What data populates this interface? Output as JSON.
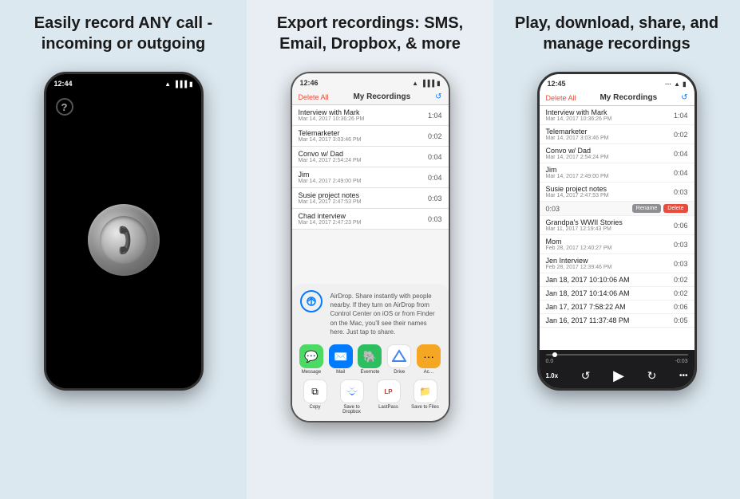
{
  "panels": [
    {
      "id": "panel-1",
      "title": "Easily record ANY call - incoming or outgoing",
      "status_time": "12:44",
      "bg": "black",
      "question_mark": "?",
      "record_button_aria": "Record button"
    },
    {
      "id": "panel-2",
      "title": "Export recordings: SMS, Email, Dropbox, & more",
      "status_time": "12:46",
      "header": {
        "delete_all": "Delete All",
        "title": "My Recordings",
        "refresh_icon": "↺"
      },
      "recordings": [
        {
          "name": "Interview with Mark",
          "date": "Mar 14, 2017 10:36:26 PM",
          "duration": "1:04"
        },
        {
          "name": "Telemarketer",
          "date": "Mar 14, 2017 3:03:46 PM",
          "duration": "0:02"
        },
        {
          "name": "Convo w/ Dad",
          "date": "Mar 14, 2017 2:54:24 PM",
          "duration": "0:04"
        },
        {
          "name": "Jim",
          "date": "Mar 14, 2017 2:49:00 PM",
          "duration": "0:04"
        },
        {
          "name": "Susie project notes",
          "date": "Mar 14, 2017 2:47:53 PM",
          "duration": "0:03"
        },
        {
          "name": "Chad interview",
          "date": "Mar 14, 2017 2:47:23 PM",
          "duration": "0:03"
        }
      ],
      "airdrop_text": "AirDrop. Share instantly with people nearby. If they turn on AirDrop from Control Center on iOS or from Finder on the Mac, you'll see their names here. Just tap to share.",
      "share_apps": [
        {
          "label": "Message",
          "color": "#4cd964",
          "icon": "💬"
        },
        {
          "label": "Mail",
          "color": "#007aff",
          "icon": "✉️"
        },
        {
          "label": "Evernote",
          "color": "#2dbe60",
          "icon": "🐘"
        },
        {
          "label": "Drive",
          "color": "#4285f4",
          "icon": "▲"
        },
        {
          "label": "Ac…",
          "color": "#f5a623",
          "icon": "⚙️"
        }
      ],
      "share_actions": [
        {
          "label": "Copy",
          "icon": "⧉"
        },
        {
          "label": "Save to Dropbox",
          "icon": "📦"
        },
        {
          "label": "LastPass",
          "icon": "⋯"
        },
        {
          "label": "Save to Files",
          "icon": "📁"
        }
      ]
    },
    {
      "id": "panel-3",
      "title": "Play, download, share, and manage recordings",
      "status_time": "12:45",
      "header": {
        "delete_all": "Delete All",
        "title": "My Recordings",
        "refresh_icon": "↺"
      },
      "recordings": [
        {
          "name": "Interview with Mark",
          "date": "Mar 14, 2017 10:36:26 PM",
          "duration": "1:04"
        },
        {
          "name": "Telemarketer",
          "date": "Mar 14, 2017 3:03:46 PM",
          "duration": "0:02"
        },
        {
          "name": "Convo w/ Dad",
          "date": "Mar 14, 2017 2:54:24 PM",
          "duration": "0:04"
        },
        {
          "name": "Jim",
          "date": "Mar 14, 2017 2:49:00 PM",
          "duration": "0:04"
        },
        {
          "name": "Susie project notes",
          "date": "Mar 14, 2017 2:47:53 PM",
          "duration": "0:03"
        }
      ],
      "active_recording": {
        "duration_left": "0:03",
        "rename_label": "Rename",
        "delete_label": "Delete"
      },
      "more_recordings": [
        {
          "name": "Grandpa's WWII Stories",
          "date": "Mar 11, 2017 12:19:43 PM",
          "duration": "0:06"
        },
        {
          "name": "Mom",
          "date": "Feb 28, 2017 12:40:27 PM",
          "duration": "0:03"
        },
        {
          "name": "Jen Interview",
          "date": "Feb 28, 2017 12:39:46 PM",
          "duration": "0:03"
        },
        {
          "name": "Jan 18, 2017 10:10:06 AM",
          "date": "",
          "duration": "0:02"
        },
        {
          "name": "Jan 18, 2017 10:14:06 AM",
          "date": "",
          "duration": "0:02"
        },
        {
          "name": "Jan 17, 2017 7:58:22 AM",
          "date": "",
          "duration": "0:06"
        },
        {
          "name": "Jan 16, 2017 11:37:48 PM",
          "date": "",
          "duration": "0:05"
        }
      ],
      "playback": {
        "start": "0.0",
        "end": "-0:03",
        "speed": "1.0x",
        "rewind_icon": "↺",
        "play_icon": "▶",
        "forward_icon": "↻",
        "more_icon": "•••"
      }
    }
  ]
}
